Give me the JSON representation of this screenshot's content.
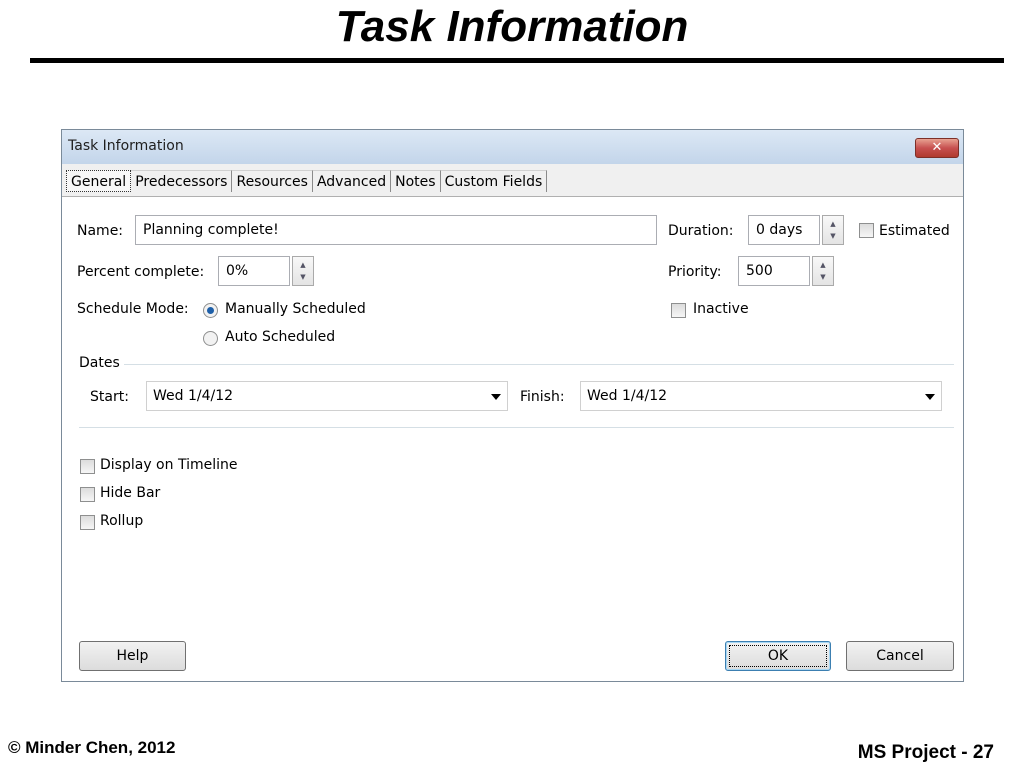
{
  "slide": {
    "title": "Task Information",
    "footer_left": "© Minder Chen, 2012",
    "footer_right": "MS Project - 27"
  },
  "dialog": {
    "title": "Task Information",
    "close_glyph": "✕",
    "tabs": [
      {
        "label": "General",
        "active": true
      },
      {
        "label": "Predecessors"
      },
      {
        "label": "Resources"
      },
      {
        "label": "Advanced"
      },
      {
        "label": "Notes"
      },
      {
        "label": "Custom Fields"
      }
    ],
    "name_label": "Name:",
    "name_value": "Planning complete!",
    "duration_label": "Duration:",
    "duration_value": "0 days",
    "estimated_label": "Estimated",
    "estimated_checked": false,
    "percent_label": "Percent complete:",
    "percent_value": "0%",
    "priority_label": "Priority:",
    "priority_value": "500",
    "schedule_mode_label": "Schedule Mode:",
    "manual_label": "Manually Scheduled",
    "auto_label": "Auto Scheduled",
    "schedule_mode_selected": "Manually Scheduled",
    "inactive_label": "Inactive",
    "inactive_checked": false,
    "dates_group_label": "Dates",
    "start_label": "Start:",
    "start_value": "Wed 1/4/12",
    "finish_label": "Finish:",
    "finish_value": "Wed 1/4/12",
    "display_timeline_label": "Display on Timeline",
    "hide_bar_label": "Hide Bar",
    "rollup_label": "Rollup",
    "help_button": "Help",
    "ok_button": "OK",
    "cancel_button": "Cancel"
  },
  "colors": {
    "titlebar": "#c3d5ea",
    "close_button": "#c75050",
    "dialog_bg": "#f0f0f0"
  },
  "icons": {
    "close": "close-icon",
    "spin_up": "spin-up-icon",
    "spin_down": "spin-down-icon",
    "dropdown": "chevron-down-icon"
  }
}
